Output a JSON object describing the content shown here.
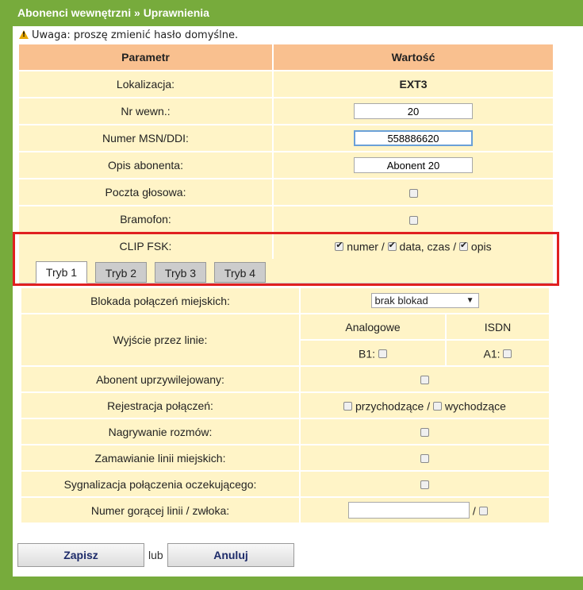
{
  "header": {
    "title": "Abonenci wewnętrzni » Uprawnienia"
  },
  "warning": {
    "text": "Uwaga: proszę zmienić hasło domyślne."
  },
  "table1": {
    "col_param": "Parametr",
    "col_value": "Wartość",
    "lokalizacja_label": "Lokalizacja:",
    "lokalizacja_value": "EXT3",
    "nr_label": "Nr wewn.:",
    "nr_value": "20",
    "msn_label": "Numer MSN/DDI:",
    "msn_value": "558886620",
    "opis_label": "Opis abonenta:",
    "opis_value": "Abonent 20",
    "poczta_label": "Poczta głosowa:",
    "bramofon_label": "Bramofon:",
    "clip_label": "CLIP FSK:",
    "clip_numer": "numer /",
    "clip_data": "data, czas /",
    "clip_opis": "opis"
  },
  "tabs": [
    "Tryb 1",
    "Tryb 2",
    "Tryb 3",
    "Tryb 4"
  ],
  "table2": {
    "blokada_label": "Blokada połączeń miejskich:",
    "blokada_value": "brak blokad",
    "wyjscie_label": "Wyjście przez linie:",
    "analogowe": "Analogowe",
    "isdn": "ISDN",
    "b1": "B1:",
    "a1": "A1:",
    "uprzyw_label": "Abonent uprzywilejowany:",
    "rejestracja_label": "Rejestracja połączeń:",
    "przychodzace": "przychodzące /",
    "wychodzace": "wychodzące",
    "nagrywanie_label": "Nagrywanie rozmów:",
    "zamawianie_label": "Zamawianie linii miejskich:",
    "sygnalizacja_label": "Sygnalizacja połączenia oczekującego:",
    "goraca_label": "Numer gorącej linii / zwłoka:",
    "goraca_sep": "/"
  },
  "buttons": {
    "save": "Zapisz",
    "or": "lub",
    "cancel": "Anuluj"
  }
}
